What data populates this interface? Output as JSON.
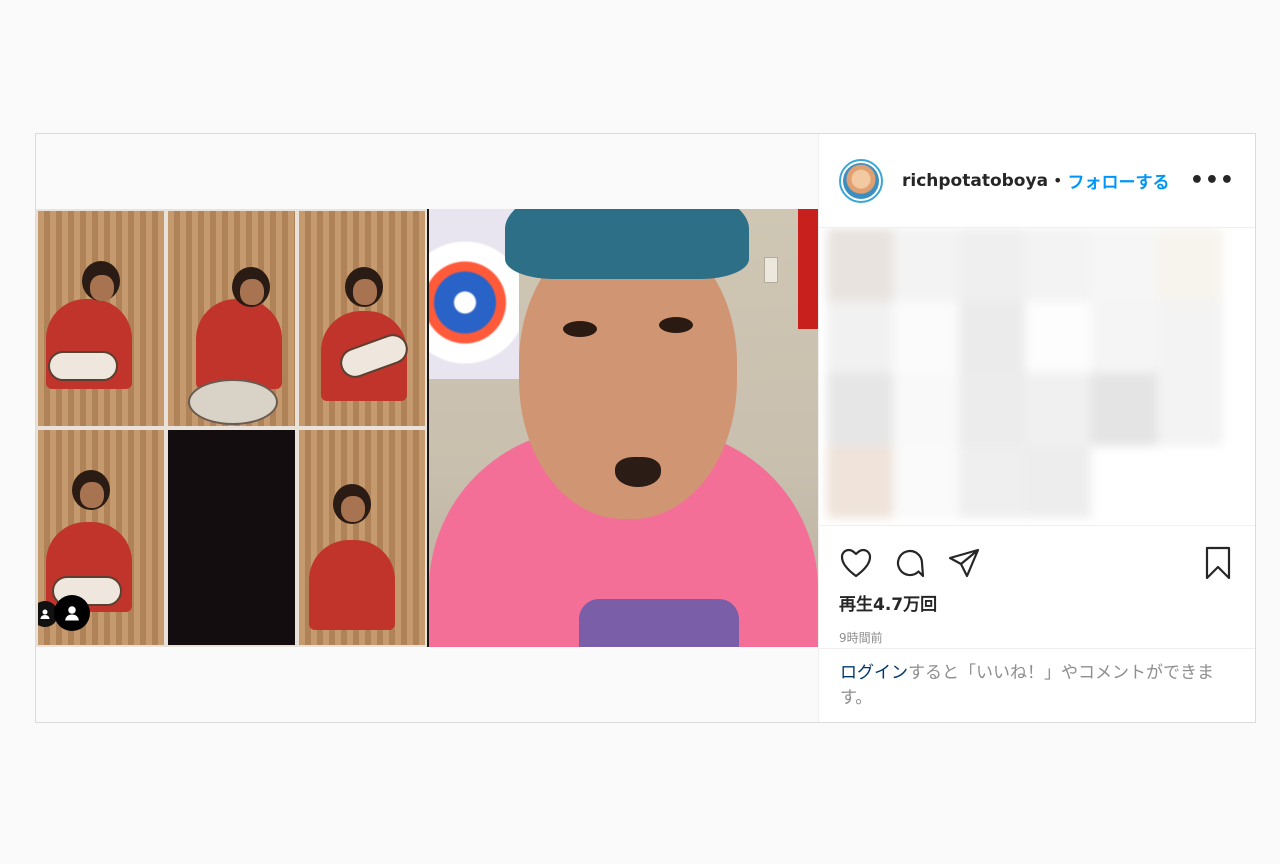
{
  "post": {
    "username": "richpotatoboya",
    "separator": "•",
    "follow_label": "フォローする",
    "more_label": "•••",
    "views": "再生4.7万回",
    "time_ago": "9時間前",
    "login_link": "ログイン",
    "login_text": "すると「いいね！」やコメントができます。"
  },
  "icons": {
    "like": "heart-icon",
    "comment": "comment-icon",
    "share": "paper-plane-icon",
    "save": "bookmark-icon",
    "tagged_user": "user-icon"
  },
  "colors": {
    "follow": "#0095f6",
    "login_link": "#00376b",
    "muted": "#8e8e8e",
    "border": "#dbdbdb"
  }
}
